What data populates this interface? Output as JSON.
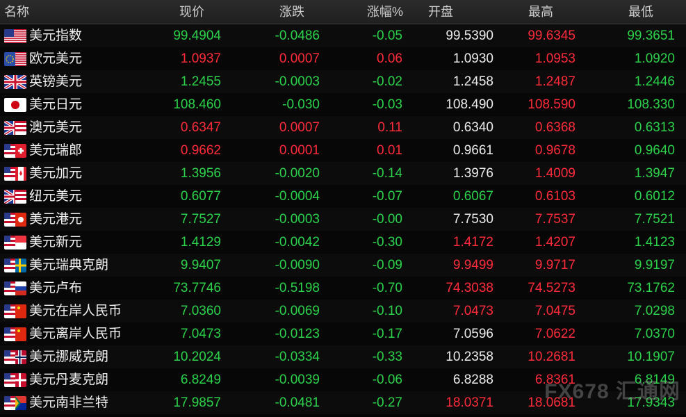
{
  "header": {
    "name": "名称",
    "price": "现价",
    "change": "涨跌",
    "change_pct": "涨幅%",
    "open": "开盘",
    "high": "最高",
    "low": "最低"
  },
  "colors": {
    "up": "#ff2b3a",
    "down": "#2bd24a",
    "flat": "#ececec"
  },
  "rows": [
    {
      "name": "美元指数",
      "flag": "us-flag-icon",
      "price": "99.4904",
      "change": "-0.0486",
      "pct": "-0.05",
      "open": "99.5390",
      "high": "99.6345",
      "low": "99.3651",
      "pc": "down",
      "cc": "down",
      "oc": "flat",
      "hc": "up",
      "lc": "down"
    },
    {
      "name": "欧元美元",
      "flag": "eu-flag-icon",
      "price": "1.0937",
      "change": "0.0007",
      "pct": "0.06",
      "open": "1.0930",
      "high": "1.0953",
      "low": "1.0920",
      "pc": "up",
      "cc": "up",
      "oc": "flat",
      "hc": "up",
      "lc": "down"
    },
    {
      "name": "英镑美元",
      "flag": "uk-flag-icon",
      "price": "1.2455",
      "change": "-0.0003",
      "pct": "-0.02",
      "open": "1.2458",
      "high": "1.2487",
      "low": "1.2446",
      "pc": "down",
      "cc": "down",
      "oc": "flat",
      "hc": "up",
      "lc": "down"
    },
    {
      "name": "美元日元",
      "flag": "jp-flag-icon",
      "price": "108.460",
      "change": "-0.030",
      "pct": "-0.03",
      "open": "108.490",
      "high": "108.590",
      "low": "108.330",
      "pc": "down",
      "cc": "down",
      "oc": "flat",
      "hc": "up",
      "lc": "down"
    },
    {
      "name": "澳元美元",
      "flag": "au-flag-icon",
      "price": "0.6347",
      "change": "0.0007",
      "pct": "0.11",
      "open": "0.6340",
      "high": "0.6368",
      "low": "0.6313",
      "pc": "up",
      "cc": "up",
      "oc": "flat",
      "hc": "up",
      "lc": "down"
    },
    {
      "name": "美元瑞郎",
      "flag": "ch-flag-icon",
      "price": "0.9662",
      "change": "0.0001",
      "pct": "0.01",
      "open": "0.9661",
      "high": "0.9678",
      "low": "0.9640",
      "pc": "up",
      "cc": "up",
      "oc": "flat",
      "hc": "up",
      "lc": "down"
    },
    {
      "name": "美元加元",
      "flag": "ca-flag-icon",
      "price": "1.3956",
      "change": "-0.0020",
      "pct": "-0.14",
      "open": "1.3976",
      "high": "1.4009",
      "low": "1.3947",
      "pc": "down",
      "cc": "down",
      "oc": "flat",
      "hc": "up",
      "lc": "down"
    },
    {
      "name": "纽元美元",
      "flag": "nz-flag-icon",
      "price": "0.6077",
      "change": "-0.0004",
      "pct": "-0.07",
      "open": "0.6067",
      "high": "0.6103",
      "low": "0.6012",
      "pc": "down",
      "cc": "down",
      "oc": "down",
      "hc": "up",
      "lc": "down"
    },
    {
      "name": "美元港元",
      "flag": "hk-flag-icon",
      "price": "7.7527",
      "change": "-0.0003",
      "pct": "-0.00",
      "open": "7.7530",
      "high": "7.7537",
      "low": "7.7521",
      "pc": "down",
      "cc": "down",
      "oc": "flat",
      "hc": "up",
      "lc": "down"
    },
    {
      "name": "美元新元",
      "flag": "sg-flag-icon",
      "price": "1.4129",
      "change": "-0.0042",
      "pct": "-0.30",
      "open": "1.4172",
      "high": "1.4207",
      "low": "1.4123",
      "pc": "down",
      "cc": "down",
      "oc": "up",
      "hc": "up",
      "lc": "down"
    },
    {
      "name": "美元瑞典克朗",
      "flag": "se-flag-icon",
      "price": "9.9407",
      "change": "-0.0090",
      "pct": "-0.09",
      "open": "9.9499",
      "high": "9.9717",
      "low": "9.9197",
      "pc": "down",
      "cc": "down",
      "oc": "up",
      "hc": "up",
      "lc": "down"
    },
    {
      "name": "美元卢布",
      "flag": "ru-flag-icon",
      "price": "73.7746",
      "change": "-0.5198",
      "pct": "-0.70",
      "open": "74.3038",
      "high": "74.5273",
      "low": "73.1762",
      "pc": "down",
      "cc": "down",
      "oc": "up",
      "hc": "up",
      "lc": "down"
    },
    {
      "name": "美元在岸人民币",
      "flag": "cn-flag-icon",
      "price": "7.0360",
      "change": "-0.0069",
      "pct": "-0.10",
      "open": "7.0473",
      "high": "7.0475",
      "low": "7.0298",
      "pc": "down",
      "cc": "down",
      "oc": "up",
      "hc": "up",
      "lc": "down"
    },
    {
      "name": "美元离岸人民币",
      "flag": "cn-flag-icon",
      "price": "7.0473",
      "change": "-0.0123",
      "pct": "-0.17",
      "open": "7.0596",
      "high": "7.0622",
      "low": "7.0370",
      "pc": "down",
      "cc": "down",
      "oc": "flat",
      "hc": "up",
      "lc": "down"
    },
    {
      "name": "美元挪威克朗",
      "flag": "no-flag-icon",
      "price": "10.2024",
      "change": "-0.0334",
      "pct": "-0.33",
      "open": "10.2358",
      "high": "10.2681",
      "low": "10.1907",
      "pc": "down",
      "cc": "down",
      "oc": "flat",
      "hc": "up",
      "lc": "down"
    },
    {
      "name": "美元丹麦克朗",
      "flag": "dk-flag-icon",
      "price": "6.8249",
      "change": "-0.0039",
      "pct": "-0.06",
      "open": "6.8288",
      "high": "6.8361",
      "low": "6.8149",
      "pc": "down",
      "cc": "down",
      "oc": "flat",
      "hc": "up",
      "lc": "down"
    },
    {
      "name": "美元南非兰特",
      "flag": "za-flag-icon",
      "price": "17.9857",
      "change": "-0.0481",
      "pct": "-0.27",
      "open": "18.0371",
      "high": "18.0681",
      "low": "17.9343",
      "pc": "down",
      "cc": "down",
      "oc": "up",
      "hc": "up",
      "lc": "down"
    }
  ],
  "watermark": "FX678 汇通网"
}
